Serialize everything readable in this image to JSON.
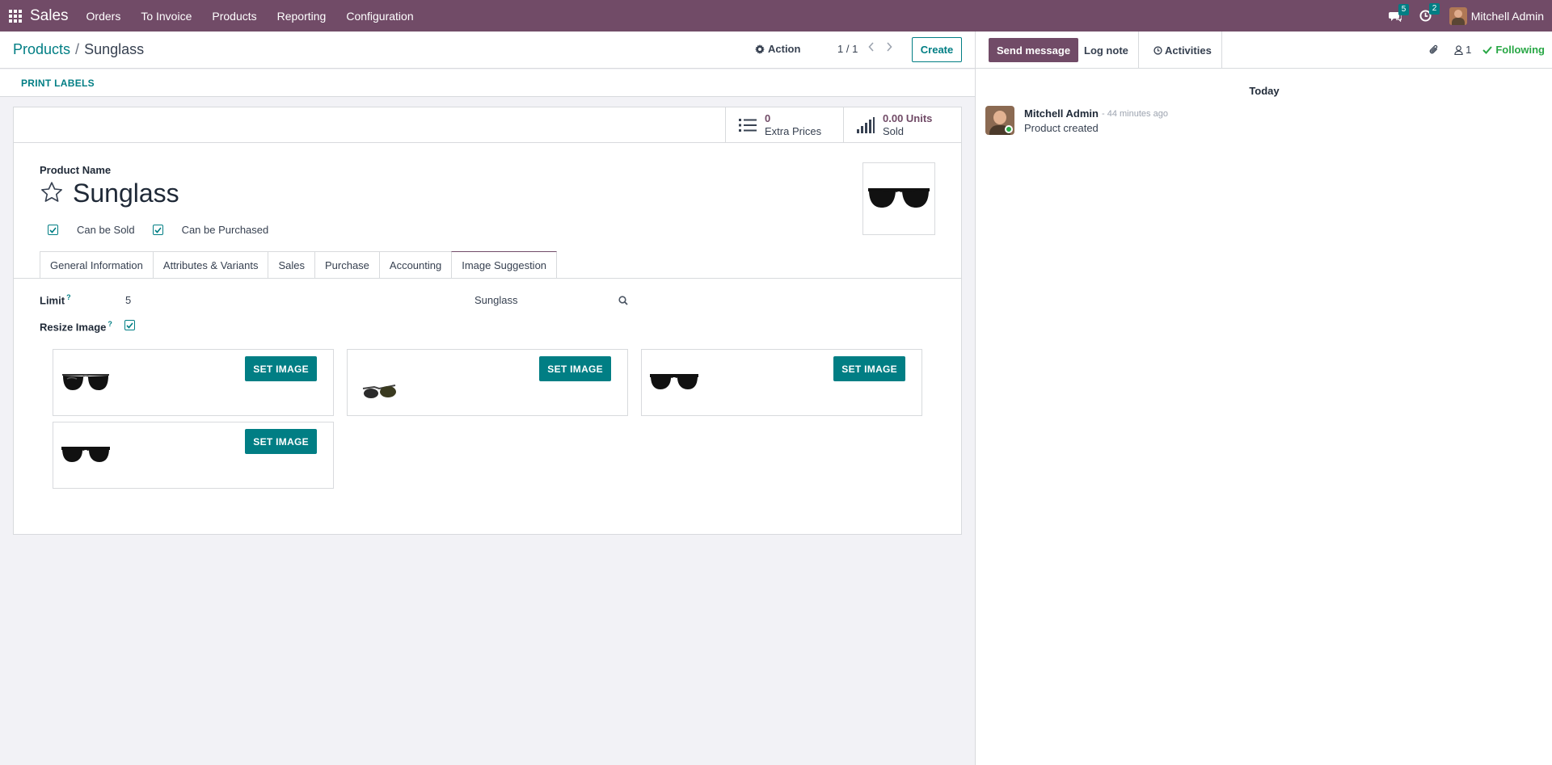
{
  "navbar": {
    "app_name": "Sales",
    "menu": [
      "Orders",
      "To Invoice",
      "Products",
      "Reporting",
      "Configuration"
    ],
    "messages_count": "5",
    "activities_count": "2",
    "user_name": "Mitchell Admin"
  },
  "control_panel": {
    "breadcrumb_parent": "Products",
    "breadcrumb_sep": "/",
    "breadcrumb_current": "Sunglass",
    "action_label": "Action",
    "pager": "1 / 1",
    "create_label": "Create"
  },
  "statusbar": {
    "print_labels": "PRINT LABELS"
  },
  "stats": {
    "extra_prices_value": "0",
    "extra_prices_label": "Extra Prices",
    "sold_value": "0.00 Units",
    "sold_label": "Sold"
  },
  "form": {
    "product_name_label": "Product Name",
    "product_name": "Sunglass",
    "can_be_sold_label": "Can be Sold",
    "can_be_purchased_label": "Can be Purchased",
    "can_be_sold": true,
    "can_be_purchased": true
  },
  "tabs": [
    "General Information",
    "Attributes & Variants",
    "Sales",
    "Purchase",
    "Accounting",
    "Image Suggestion"
  ],
  "active_tab": "Image Suggestion",
  "image_suggestion": {
    "limit_label": "Limit",
    "limit_value": "5",
    "search_value": "Sunglass",
    "resize_label": "Resize Image",
    "resize_checked": true,
    "help_mark": "?",
    "set_image_label": "SET IMAGE",
    "suggestions_count": 4
  },
  "chatter": {
    "send_message": "Send message",
    "log_note": "Log note",
    "activities": "Activities",
    "followers_count": "1",
    "following": "Following",
    "date_separator": "Today",
    "messages": [
      {
        "author": "Mitchell Admin",
        "time": "- 44 minutes ago",
        "body": "Product created"
      }
    ]
  },
  "colors": {
    "brand": "#714b67",
    "accent": "#017e84",
    "success": "#28a745"
  }
}
